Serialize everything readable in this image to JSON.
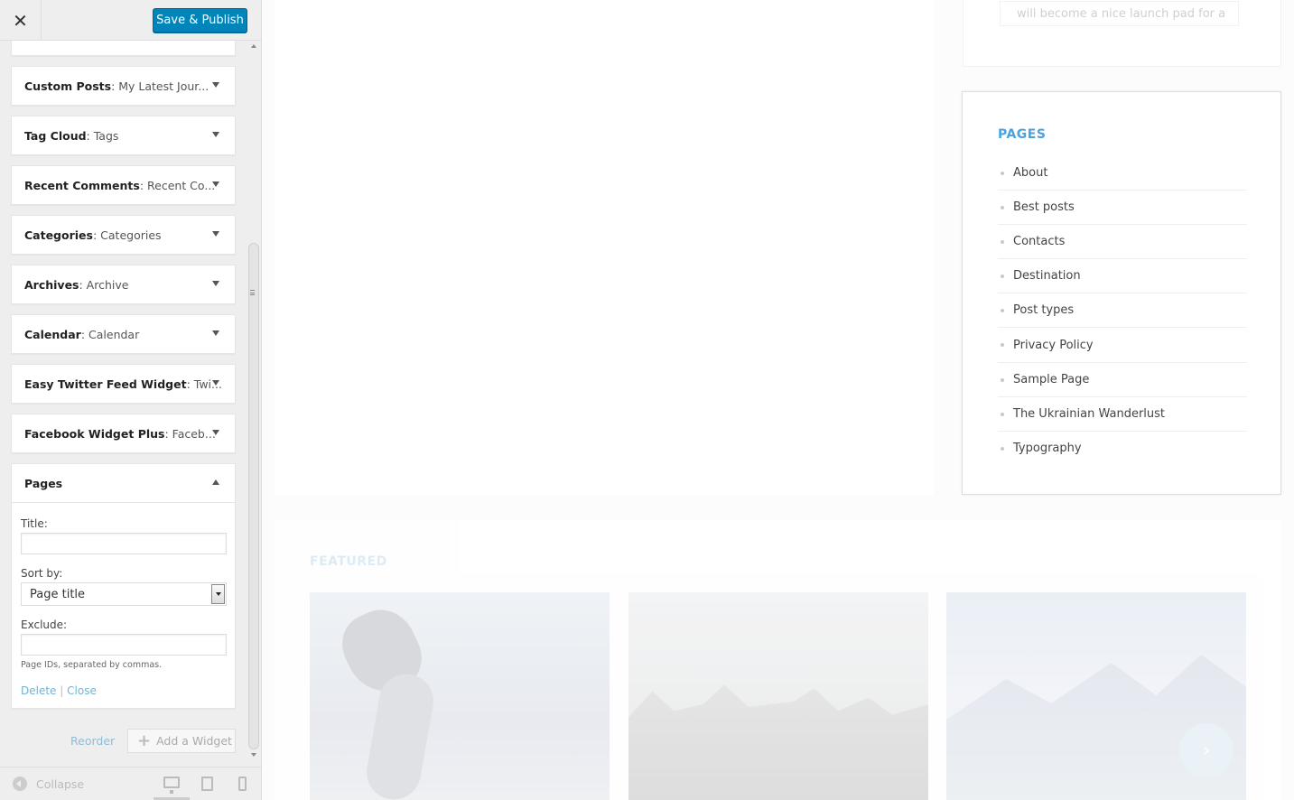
{
  "topbar": {
    "close_icon": "✕",
    "publish_label": "Save & Publish"
  },
  "widgets": [
    {
      "name": "Custom Posts",
      "sub": ": My Latest Jour..."
    },
    {
      "name": "Tag Cloud",
      "sub": ": Tags"
    },
    {
      "name": "Recent Comments",
      "sub": ": Recent Co..."
    },
    {
      "name": "Categories",
      "sub": ": Categories"
    },
    {
      "name": "Archives",
      "sub": ": Archive"
    },
    {
      "name": "Calendar",
      "sub": ": Calendar"
    },
    {
      "name": "Easy Twitter Feed Widget",
      "sub": ": Twi..."
    },
    {
      "name": "Facebook Widget Plus",
      "sub": ": Faceb..."
    }
  ],
  "pages_widget": {
    "name": "Pages",
    "title_label": "Title:",
    "title_value": "",
    "sort_label": "Sort by:",
    "sort_value": "Page title",
    "exclude_label": "Exclude:",
    "exclude_value": "",
    "help_text": "Page IDs, separated by commas.",
    "delete_label": "Delete",
    "separator": "|",
    "close_label": "Close"
  },
  "sidebar_actions": {
    "reorder_label": "Reorder",
    "add_widget_label": "Add a Widget"
  },
  "footer": {
    "collapse_label": "Collapse"
  },
  "preview": {
    "top_snippet": "will become a nice launch pad for a",
    "pages_title": "PAGES",
    "pages": [
      "About",
      "Best posts",
      "Contacts",
      "Destination",
      "Post types",
      "Privacy Policy",
      "Sample Page",
      "The Ukrainian Wanderlust",
      "Typography"
    ],
    "featured_title": "FEATURED",
    "next_arrow": "›"
  },
  "colors": {
    "publish_bg": "#0085ba",
    "pages_title": "#4aa3df",
    "sidebar_bg": "#eeeeee"
  },
  "icons": [
    "close-icon",
    "chevron-down-icon",
    "chevron-up-icon",
    "plus-icon",
    "collapse-icon",
    "desktop-icon",
    "tablet-icon",
    "mobile-icon"
  ]
}
